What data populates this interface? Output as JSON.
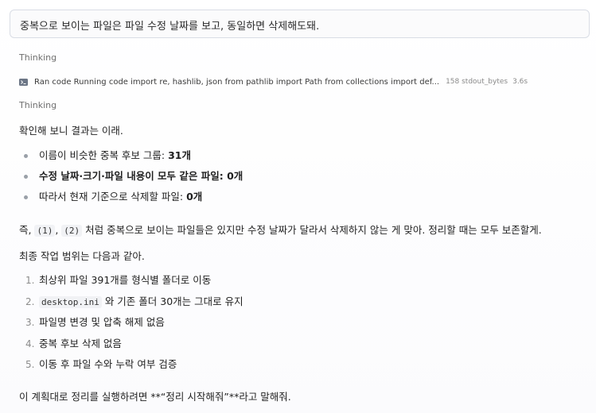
{
  "user_message": "중복으로 보이는 파일은 파일 수정 날짜를 보고, 동일하면 삭제해도돼.",
  "thinking_label_1": "Thinking",
  "run": {
    "label": "Ran code Running code import re, hashlib, json from pathlib import Path from collections import def...",
    "meta": "158 stdout_bytes",
    "time": "3.6s"
  },
  "thinking_label_2": "Thinking",
  "intro": "확인해 보니 결과는 이래.",
  "bullets": [
    {
      "text": "이름이 비슷한 중복 후보 그룹: ",
      "bold": "31개"
    },
    {
      "bold": "수정 날짜·크기·파일 내용이 모두 같은 파일: 0개"
    },
    {
      "text": "따라서 현재 기준으로 삭제할 파일: ",
      "bold": "0개"
    }
  ],
  "note": {
    "prefix": "즉, ",
    "code1": "(1)",
    "sep": ", ",
    "code2": "(2)",
    "rest": " 처럼 중복으로 보이는 파일들은 있지만 수정 날짜가 달라서 삭제하지 않는 게 맞아. 정리할 때는 모두 보존할게."
  },
  "scope_title": "최종 작업 범위는 다음과 같아.",
  "steps": [
    {
      "num": "1.",
      "text": "최상위 파일 391개를 형식별 폴더로 이동"
    },
    {
      "num": "2.",
      "code": "desktop.ini",
      "text": " 와 기존 폴더 30개는 그대로 유지"
    },
    {
      "num": "3.",
      "text": "파일명 변경 및 압축 해제 없음"
    },
    {
      "num": "4.",
      "text": "중복 후보 삭제 없음"
    },
    {
      "num": "5.",
      "text": "이동 후 파일 수와 누락 여부 검증"
    }
  ],
  "final": "이 계획대로 정리를 실행하려면 **“정리 시작해줘”**라고 말해줘."
}
